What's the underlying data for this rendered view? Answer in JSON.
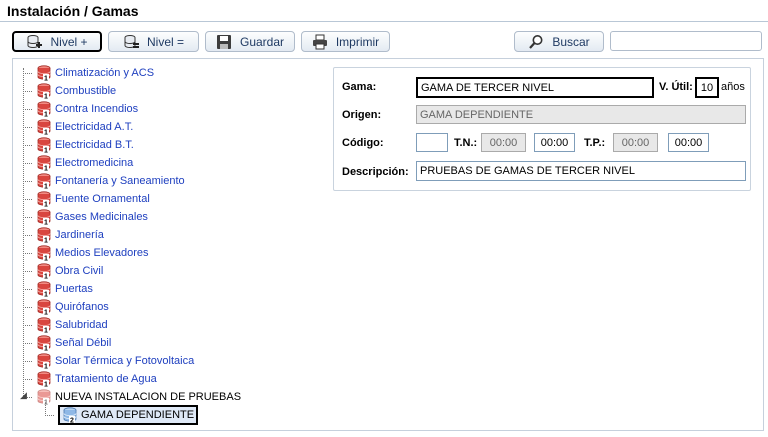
{
  "header": {
    "title": "Instalación / Gamas"
  },
  "toolbar": {
    "nivel_plus": "Nivel +",
    "nivel_eq": "Nivel =",
    "guardar": "Guardar",
    "imprimir": "Imprimir",
    "buscar": "Buscar",
    "search_value": ""
  },
  "tree": {
    "items": [
      {
        "label": "Climatización y ACS"
      },
      {
        "label": "Combustible"
      },
      {
        "label": "Contra Incendios"
      },
      {
        "label": "Electricidad A.T."
      },
      {
        "label": "Electricidad B.T."
      },
      {
        "label": "Electromedicina"
      },
      {
        "label": "Fontanería y Saneamiento"
      },
      {
        "label": "Fuente Ornamental"
      },
      {
        "label": "Gases Medicinales"
      },
      {
        "label": "Jardinería"
      },
      {
        "label": "Medios Elevadores"
      },
      {
        "label": "Obra Civil"
      },
      {
        "label": "Puertas"
      },
      {
        "label": "Quirófanos"
      },
      {
        "label": "Salubridad"
      },
      {
        "label": "Señal Débil"
      },
      {
        "label": "Solar Térmica y Fotovoltaica"
      },
      {
        "label": "Tratamiento de Agua"
      }
    ],
    "expanded": {
      "label": "NUEVA INSTALACION DE PRUEBAS"
    },
    "child": {
      "label": "GAMA DEPENDIENTE",
      "badge": "2"
    },
    "badge_level1": "1"
  },
  "form": {
    "gama_label": "Gama:",
    "gama_value": "GAMA DE TERCER NIVEL",
    "vutil_label": "V. Útil:",
    "vutil_value": "10",
    "anos_label": "años",
    "origen_label": "Origen:",
    "origen_value": "GAMA DEPENDIENTE",
    "codigo_label": "Código:",
    "codigo_value": "",
    "tn_label": "T.N.:",
    "tn_value1": "00:00",
    "tn_value2": "00:00",
    "tp_label": "T.P.:",
    "tp_value1": "00:00",
    "tp_value2": "00:00",
    "descripcion_label": "Descripción:",
    "descripcion_value": "PRUEBAS DE GAMAS DE TERCER NIVEL"
  },
  "colors": {
    "link": "#1e3fbf",
    "db_icon": "#d9463f",
    "button_text": "#1f3a63"
  }
}
